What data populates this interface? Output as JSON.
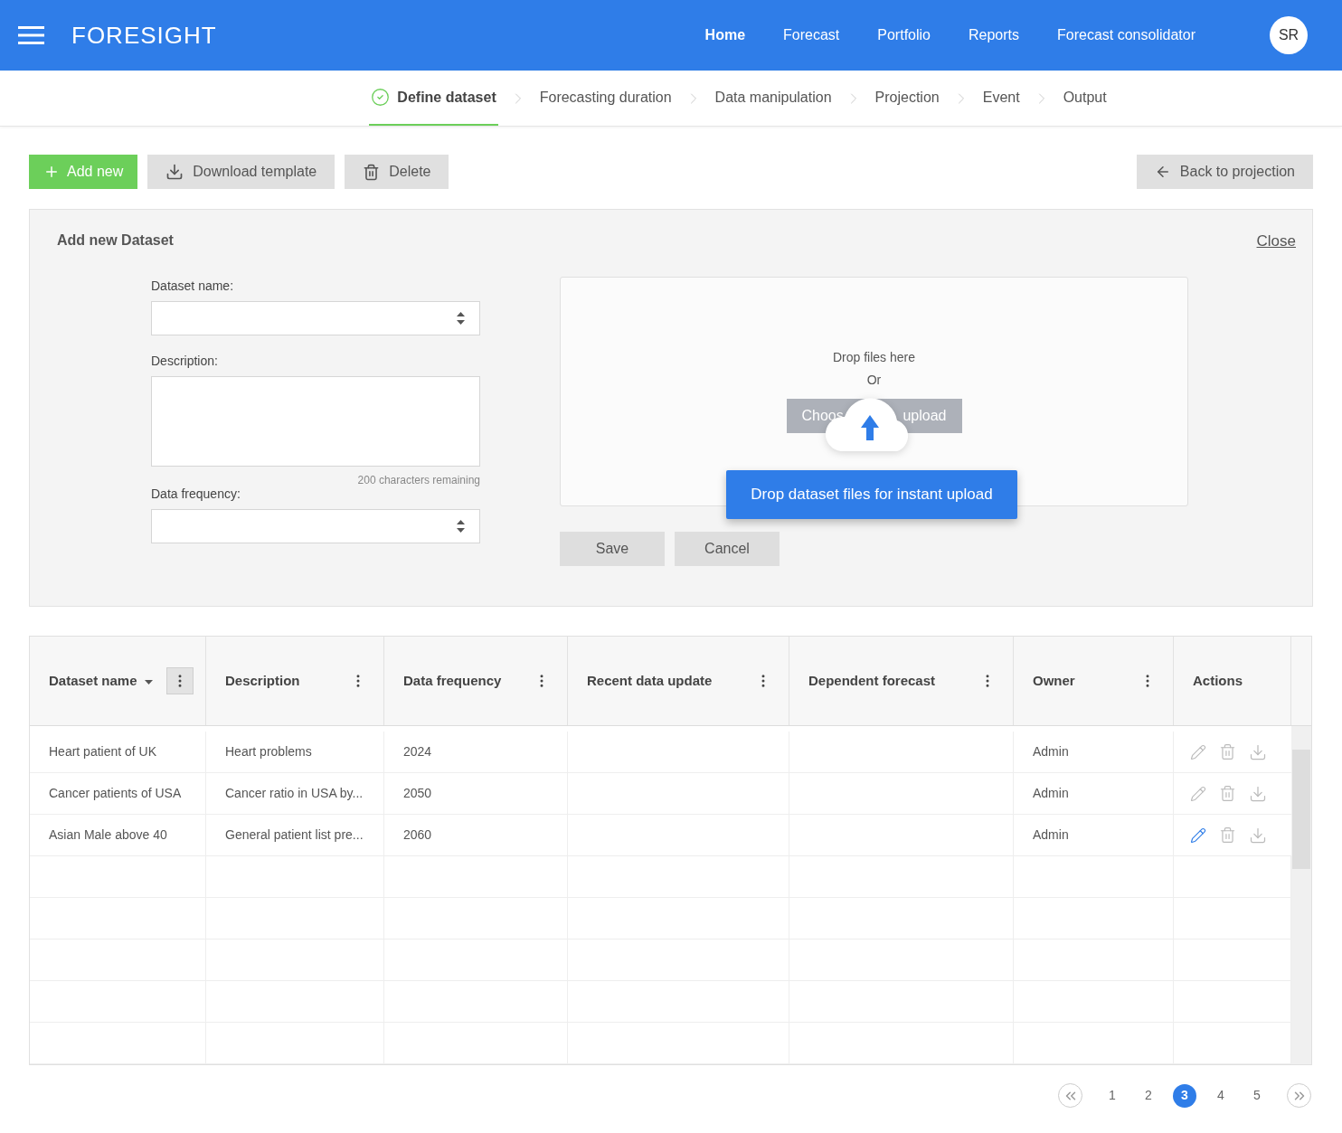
{
  "app": {
    "title": "FORESIGHT",
    "avatar": "SR"
  },
  "nav": [
    {
      "label": "Home",
      "selected": true
    },
    {
      "label": "Forecast",
      "selected": false
    },
    {
      "label": "Portfolio",
      "selected": false
    },
    {
      "label": "Reports",
      "selected": false
    },
    {
      "label": "Forecast consolidator",
      "selected": false
    }
  ],
  "steps": [
    {
      "label": "Define dataset",
      "selected": true,
      "done": true
    },
    {
      "label": "Forecasting duration",
      "selected": false,
      "done": false
    },
    {
      "label": "Data manipulation",
      "selected": false,
      "done": false
    },
    {
      "label": "Projection",
      "selected": false,
      "done": false
    },
    {
      "label": "Event",
      "selected": false,
      "done": false
    },
    {
      "label": "Output",
      "selected": false,
      "done": false
    }
  ],
  "toolbar": {
    "add": "Add new",
    "download": "Download template",
    "delete": "Delete",
    "back": "Back to projection"
  },
  "panel": {
    "title": "Add new Dataset",
    "close": "Close",
    "dataset_name": {
      "label": "Dataset name:"
    },
    "description": {
      "label": "Description:",
      "hint": "200 characters remaining"
    },
    "data_frequency": {
      "label": "Data frequency:"
    },
    "dropzone": {
      "text": "Drop files here",
      "or": "Or",
      "choose_start": "Choos",
      "choose_end": "upload",
      "tooltip": "Drop dataset files for instant upload"
    },
    "save": "Save",
    "cancel": "Cancel"
  },
  "table": {
    "columns": [
      {
        "label": "Dataset name",
        "sorted": true,
        "menu": true,
        "menu_selected": true
      },
      {
        "label": "Description",
        "sorted": false,
        "menu": true,
        "menu_selected": false
      },
      {
        "label": "Data frequency",
        "sorted": false,
        "menu": true,
        "menu_selected": false
      },
      {
        "label": "Recent data update",
        "sorted": false,
        "menu": true,
        "menu_selected": false
      },
      {
        "label": "Dependent forecast",
        "sorted": false,
        "menu": true,
        "menu_selected": false
      },
      {
        "label": "Owner",
        "sorted": false,
        "menu": true,
        "menu_selected": false
      },
      {
        "label": "Actions",
        "sorted": false,
        "menu": false
      }
    ],
    "rows": [
      {
        "cells": [
          "Heart patient of UK",
          "Heart problems",
          "2024",
          "",
          "",
          "Admin"
        ],
        "edit_highlighted": false
      },
      {
        "cells": [
          "Cancer patients of USA",
          "Cancer ratio in USA by...",
          "2050",
          "",
          "",
          "Admin"
        ],
        "edit_highlighted": false
      },
      {
        "cells": [
          "Asian Male above 40",
          "General patient list pre...",
          "2060",
          "",
          "",
          "Admin"
        ],
        "edit_highlighted": true
      }
    ]
  },
  "pagination": {
    "pages": [
      {
        "label": "1",
        "selected": false
      },
      {
        "label": "2",
        "selected": false
      },
      {
        "label": "3",
        "selected": true
      },
      {
        "label": "4",
        "selected": false
      },
      {
        "label": "5",
        "selected": false
      }
    ]
  }
}
